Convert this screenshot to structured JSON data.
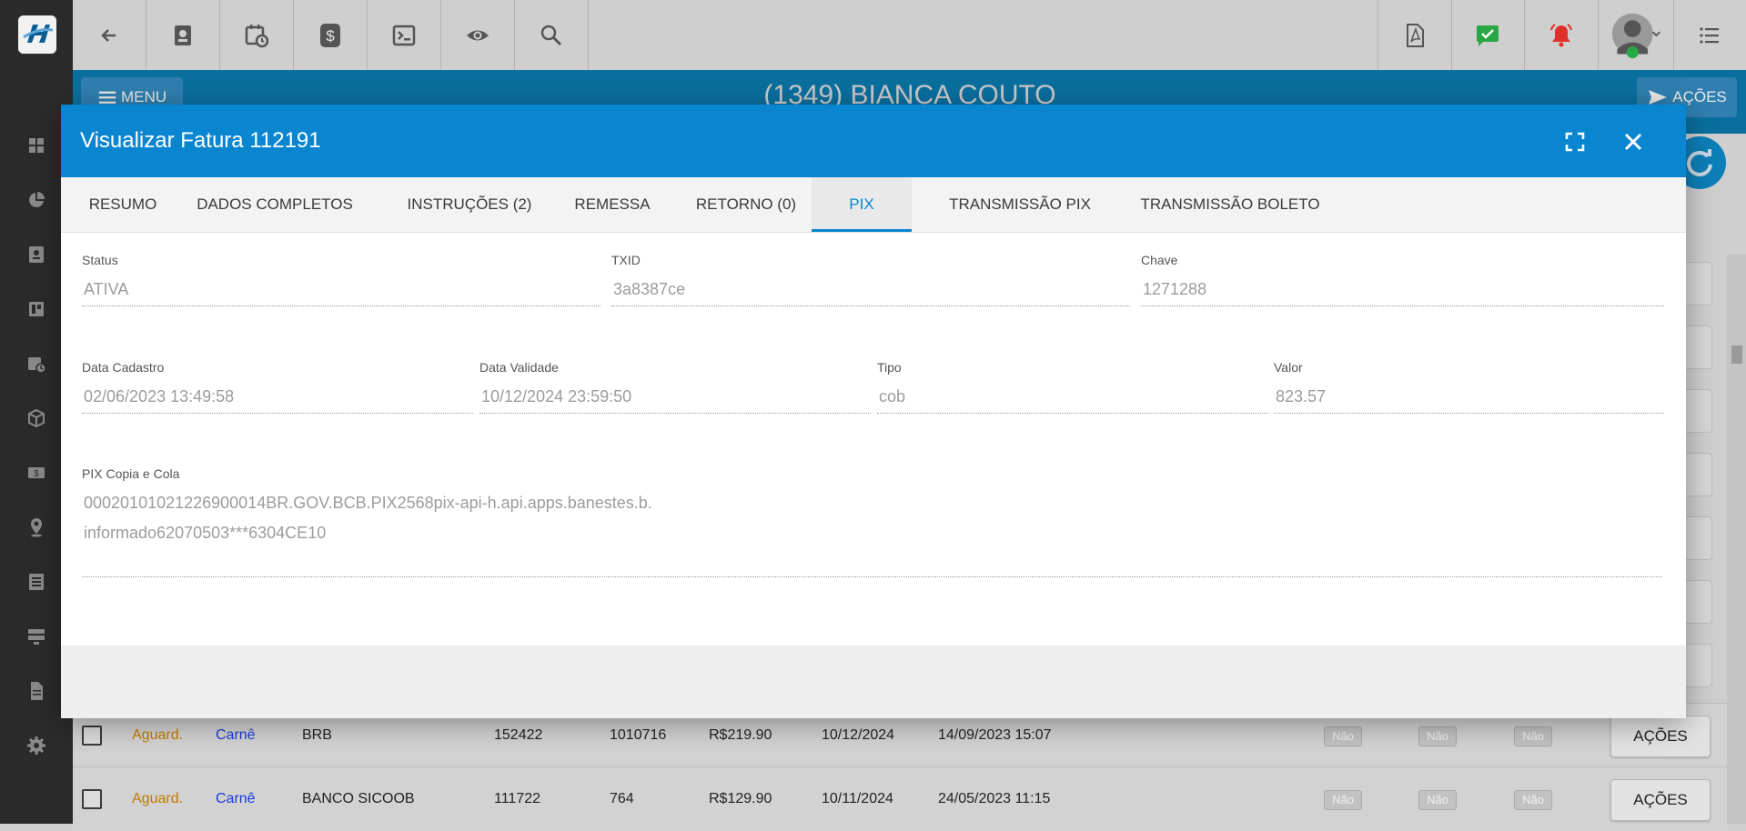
{
  "app": {
    "page_title": "(1349) BIANCA COUTO",
    "menu_label": "MENU",
    "acoes_label": "AÇÕES"
  },
  "modal": {
    "title": "Visualizar Fatura 112191",
    "tabs": [
      {
        "label": "RESUMO"
      },
      {
        "label": "DADOS COMPLETOS"
      },
      {
        "label": "INSTRUÇÕES (2)"
      },
      {
        "label": "REMESSA"
      },
      {
        "label": "RETORNO (0)"
      },
      {
        "label": "PIX"
      },
      {
        "label": "TRANSMISSÃO PIX"
      },
      {
        "label": "TRANSMISSÃO BOLETO"
      }
    ],
    "active_tab": "PIX",
    "fields": {
      "status": {
        "label": "Status",
        "value": "ATIVA"
      },
      "txid": {
        "label": "TXID",
        "value": "3a8387ce"
      },
      "chave": {
        "label": "Chave",
        "value": "1271288"
      },
      "data_cadastro": {
        "label": "Data Cadastro",
        "value": "02/06/2023 13:49:58"
      },
      "data_validade": {
        "label": "Data Validade",
        "value": "10/12/2024 23:59:50"
      },
      "tipo": {
        "label": "Tipo",
        "value": "cob"
      },
      "valor": {
        "label": "Valor",
        "value": "823.57"
      },
      "pix_copia_cola": {
        "label": "PIX Copia e Cola",
        "line1": "00020101021226900014BR.GOV.BCB.PIX2568pix-api-h.api.apps.banestes.b.",
        "line2": "informado62070503***6304CE10"
      }
    }
  },
  "table": {
    "rows": [
      {
        "status": "Aguard.",
        "tipo": "Carnê",
        "banco": "BRB",
        "num1": "152422",
        "num2": "1010716",
        "valor": "R$219.90",
        "vencimento": "10/12/2024",
        "criado": "14/09/2023 15:07",
        "flags": [
          "Não",
          "Não",
          "Não"
        ],
        "action": "AÇÕES"
      },
      {
        "status": "Aguard.",
        "tipo": "Carnê",
        "banco": "BANCO SICOOB",
        "num1": "111722",
        "num2": "764",
        "valor": "R$129.90",
        "vencimento": "10/11/2024",
        "criado": "24/05/2023 11:15",
        "flags": [
          "Não",
          "Não",
          "Não"
        ],
        "action": "AÇÕES"
      }
    ]
  },
  "colors": {
    "modal_header": "#0a86d1",
    "active_tab": "#0a86d1",
    "sidebar": "#2b2b2b",
    "status_pending": "#c47a00",
    "tipo_link": "#1a3bd6"
  },
  "icons": {
    "sidebar": [
      "dashboard-icon",
      "pie-chart-icon",
      "contact-card-icon",
      "board-icon",
      "calendar-clock-icon",
      "box-icon",
      "money-icon",
      "map-pin-icon",
      "list-icon",
      "server-icon",
      "document-icon",
      "settings-icon"
    ],
    "toolbar": [
      "back-arrow-icon",
      "contact-card-icon",
      "calendar-clock-icon",
      "dollar-icon",
      "terminal-icon",
      "eye-icon",
      "search-icon",
      "pdf-icon",
      "check-message-icon",
      "alarm-bell-icon",
      "avatar",
      "menu-list-icon"
    ]
  }
}
